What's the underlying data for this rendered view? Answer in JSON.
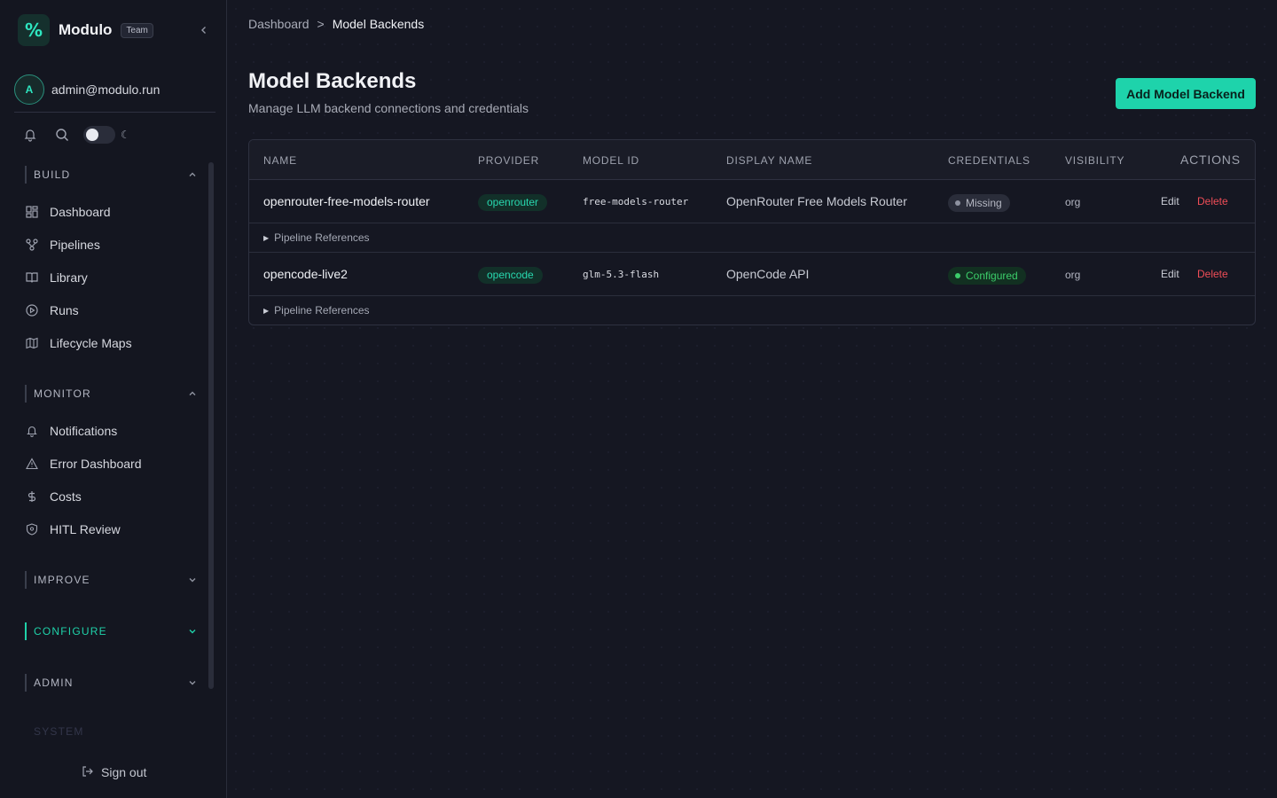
{
  "sidebar": {
    "brand": {
      "logo_glyph": "%",
      "name": "Modulo",
      "badge": "Team"
    },
    "user": {
      "initial": "A",
      "email": "admin@modulo.run"
    },
    "sections": [
      {
        "title": "BUILD",
        "items": [
          {
            "label": "Dashboard",
            "icon": "grid-icon"
          },
          {
            "label": "Pipelines",
            "icon": "pipeline-icon"
          },
          {
            "label": "Library",
            "icon": "book-icon"
          },
          {
            "label": "Runs",
            "icon": "play-circle-icon"
          },
          {
            "label": "Lifecycle Maps",
            "icon": "map-icon"
          }
        ]
      },
      {
        "title": "MONITOR",
        "items": [
          {
            "label": "Notifications",
            "icon": "bell-icon"
          },
          {
            "label": "Error Dashboard",
            "icon": "warning-icon"
          },
          {
            "label": "Costs",
            "icon": "dollar-icon"
          },
          {
            "label": "HITL Review",
            "icon": "shield-icon"
          }
        ]
      },
      {
        "title": "IMPROVE",
        "items": []
      },
      {
        "title": "CONFIGURE",
        "items": []
      },
      {
        "title": "ADMIN",
        "items": []
      },
      {
        "title": "SYSTEM",
        "items": []
      }
    ],
    "signout": "Sign out"
  },
  "breadcrumb": {
    "parent": "Dashboard",
    "separator": ">",
    "current": "Model Backends"
  },
  "page": {
    "title": "Model Backends",
    "subtitle": "Manage LLM backend connections and credentials",
    "add_button": "Add Model Backend"
  },
  "table": {
    "headers": [
      "NAME",
      "PROVIDER",
      "MODEL ID",
      "DISPLAY NAME",
      "CREDENTIALS",
      "VISIBILITY",
      "ACTIONS"
    ],
    "rows": [
      {
        "name": "openrouter-free-models-router",
        "provider": "openrouter",
        "model_id": "free-models-router",
        "display_name": "OpenRouter Free Models Router",
        "credentials": "Missing",
        "visibility": "org",
        "edit": "Edit",
        "delete": "Delete",
        "refs": "Pipeline References"
      },
      {
        "name": "opencode-live2",
        "provider": "opencode",
        "model_id": "glm-5.3-flash",
        "display_name": "OpenCode API",
        "credentials": "Configured",
        "visibility": "org",
        "edit": "Edit",
        "delete": "Delete",
        "refs": "Pipeline References"
      }
    ]
  },
  "colors": {
    "accent": "#1ed3ab",
    "danger": "#ef4d57",
    "success": "#3ccd6a",
    "background": "#151722"
  }
}
